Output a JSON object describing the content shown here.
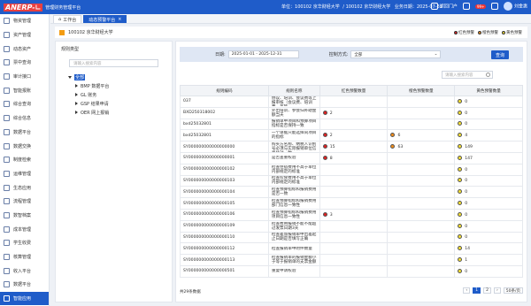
{
  "header": {
    "logo_mark": "ANERP-∟",
    "system_name": "管理财务管理平台",
    "unit_label": "单位：",
    "unit_value": "100102 京华财经大学",
    "account_label": "100102 京华财经大学",
    "business_date_label": "业务日期：",
    "business_date": "2025-07-31",
    "portal_button": "返回门户",
    "badge_count": "99+",
    "user_name": "刘金惠"
  },
  "sidebar": {
    "items": [
      {
        "label": "物资管理"
      },
      {
        "label": "资产管理"
      },
      {
        "label": "动态资产"
      },
      {
        "label": "票中查询"
      },
      {
        "label": "审计接口"
      },
      {
        "label": "智能报账"
      },
      {
        "label": "综合查询"
      },
      {
        "label": "综合信息"
      },
      {
        "label": "数据平台"
      },
      {
        "label": "数据交换"
      },
      {
        "label": "制度检索"
      },
      {
        "label": "运维管理"
      },
      {
        "label": "生态应用"
      },
      {
        "label": "流程管理"
      },
      {
        "label": "数智档案"
      },
      {
        "label": "成本管理"
      },
      {
        "label": "学生收费"
      },
      {
        "label": "核算管理"
      },
      {
        "label": "收入平台"
      },
      {
        "label": "数据平台"
      },
      {
        "label": "智能应用"
      }
    ]
  },
  "tabs": [
    {
      "label": "工作台"
    },
    {
      "label": "动态预警平台"
    }
  ],
  "org": {
    "title": "100102 京华财经大学"
  },
  "legend": {
    "red": "红色预警",
    "orange": "橙色预警",
    "yellow": "黄色预警",
    "colors": {
      "red": "#e02020",
      "orange": "#f08c1a",
      "yellow": "#f5e032"
    }
  },
  "left_panel": {
    "title": "规则类型",
    "search_placeholder": "请输入搜索内容",
    "tree": [
      {
        "label": "全部"
      },
      {
        "label": "BMP 数据平台"
      },
      {
        "label": "GL 账务"
      },
      {
        "label": "GSP 结果申请"
      },
      {
        "label": "OER 网上报销"
      }
    ]
  },
  "filter": {
    "date_label": "日期:",
    "date_value": "2025-01-01 - 2025-12-31",
    "control_label": "控制方式:",
    "control_value": "全部",
    "query_button": "查询",
    "table_search_placeholder": "请输入搜索内容"
  },
  "table": {
    "columns": [
      "规则编码",
      "规则名称",
      "红色预警数量",
      "橙色预警数量",
      "黄色预警数量"
    ],
    "rows": [
      {
        "code": "037",
        "name": "协议、培训、会议费等上报审核（会议费、培训费、差旅…",
        "red": "",
        "orange": "",
        "yellow": "0"
      },
      {
        "code": "BXD250318002",
        "name": "外出培训、参会归补助金额当天",
        "red": "2",
        "orange": "",
        "yellow": "0"
      },
      {
        "code": "bxd25032801",
        "name": "报销单中项目和预算项目指标是否保持一致",
        "red": "",
        "orange": "",
        "yellow": "0"
      },
      {
        "code": "bxd25032801",
        "name": "一个单据只能选择同项目的指标",
        "red": "2",
        "orange": "6",
        "yellow": "4"
      },
      {
        "code": "SY000000000000000000",
        "name": "购买方名称、纳税人识别号必须与实际报销单位信息比对一致",
        "red": "15",
        "orange": "63",
        "yellow": "149"
      },
      {
        "code": "SY000000000000000001",
        "name": "是否查重校验",
        "red": "8",
        "orange": "",
        "yellow": "147"
      },
      {
        "code": "SY000000000000000102",
        "name": "检查住宿费用不高于单位内部规定的标准",
        "red": "",
        "orange": "",
        "yellow": "0"
      },
      {
        "code": "SY000000000000000103",
        "name": "检查伙食费用不高于单位内部规定的标准",
        "red": "",
        "orange": "",
        "yellow": "0"
      },
      {
        "code": "SY000000000000000104",
        "name": "检查预算指标和报销费用是否一致",
        "red": "",
        "orange": "",
        "yellow": "0"
      },
      {
        "code": "SY000000000000000105",
        "name": "检查预算指标和报销费用部门信息一致性",
        "red": "",
        "orange": "",
        "yellow": "0"
      },
      {
        "code": "SY000000000000000106",
        "name": "检查预算指标和报销费用项目信息一致性",
        "red": "3",
        "orange": "",
        "yellow": "0"
      },
      {
        "code": "SY000000000000000109",
        "name": "检查费用报销不能不能超过发票日期3天",
        "red": "",
        "orange": "",
        "yellow": "0"
      },
      {
        "code": "SY000000000000000110",
        "name": "检查差旅报销单中出差起止日期是否填写正确",
        "red": "",
        "orange": "",
        "yellow": "0"
      },
      {
        "code": "SY000000000000000112",
        "name": "检查报销单中附件数量",
        "red": "",
        "orange": "",
        "yellow": "14"
      },
      {
        "code": "SY000000000000000113",
        "name": "检查报销单的报销金额小于等于报销单的支票金额",
        "red": "",
        "orange": "",
        "yellow": "1"
      },
      {
        "code": "SY000000000000000501",
        "name": "重复申请校验",
        "red": "",
        "orange": "",
        "yellow": "0"
      }
    ]
  },
  "footer": {
    "total": "共29条数据",
    "pages": [
      "1",
      "2"
    ],
    "current_page": "1",
    "page_size": "50条/页"
  }
}
